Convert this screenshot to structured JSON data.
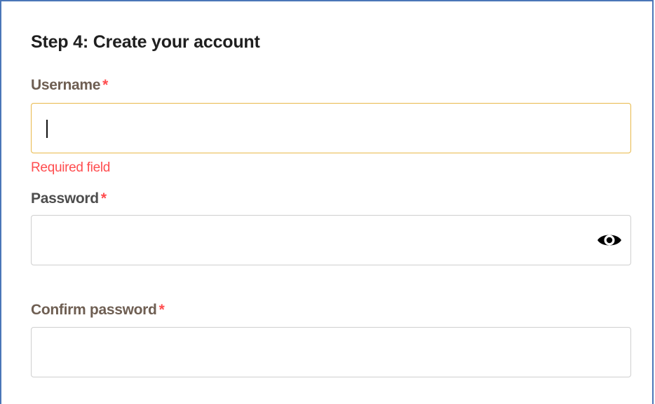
{
  "form": {
    "title": "Step 4: Create your account",
    "required_marker": "*",
    "username": {
      "label": "Username",
      "value": "",
      "error": "Required field"
    },
    "password": {
      "label": "Password",
      "value": "",
      "toggle_icon": "eye-icon"
    },
    "confirm_password": {
      "label": "Confirm password",
      "value": ""
    }
  },
  "colors": {
    "error": "#ff4d4f",
    "focus_border": "#e9b94a",
    "frame_border": "#4a76b8"
  }
}
